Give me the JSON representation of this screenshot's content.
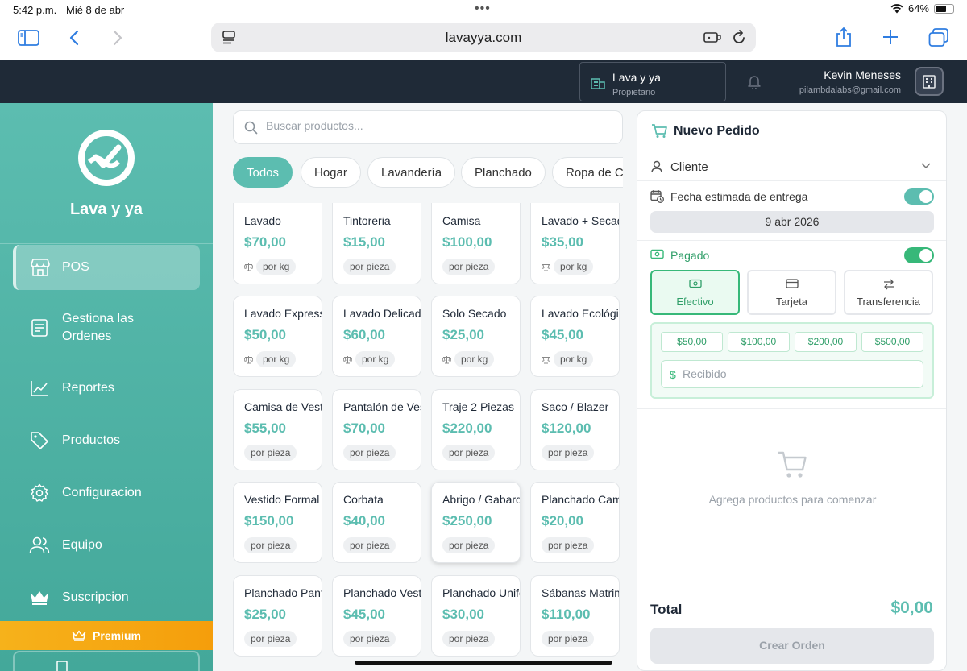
{
  "status_bar": {
    "time": "5:42 p.m.",
    "date": "Mié 8 de abr",
    "battery": "64%",
    "battery_level": 0.64
  },
  "browser": {
    "url": "lavayya.com"
  },
  "header": {
    "business_name": "Lava y ya",
    "business_role": "Propietario",
    "user_name": "Kevin Meneses",
    "user_email": "pilambdalabs@gmail.com"
  },
  "sidebar": {
    "brand": "Lava y ya",
    "items": [
      {
        "label": "POS",
        "icon": "store-icon",
        "active": true
      },
      {
        "label": "Gestiona las Ordenes",
        "icon": "clipboard-icon",
        "active": false
      },
      {
        "label": "Reportes",
        "icon": "chart-line-icon",
        "active": false
      },
      {
        "label": "Productos",
        "icon": "tag-icon",
        "active": false
      },
      {
        "label": "Configuracion",
        "icon": "gear-icon",
        "active": false
      },
      {
        "label": "Equipo",
        "icon": "users-icon",
        "active": false
      },
      {
        "label": "Suscripcion",
        "icon": "crown-icon",
        "active": false
      }
    ],
    "premium_label": "Premium"
  },
  "search": {
    "placeholder": "Buscar productos..."
  },
  "categories": [
    "Todos",
    "Hogar",
    "Lavandería",
    "Planchado",
    "Ropa de Cama"
  ],
  "active_category": "Todos",
  "products": [
    {
      "name": "Lavado",
      "price": "$70,00",
      "unit": "por kg"
    },
    {
      "name": "Tintoreria",
      "price": "$15,00",
      "unit": "por pieza"
    },
    {
      "name": "Camisa",
      "price": "$100,00",
      "unit": "por pieza"
    },
    {
      "name": "Lavado + Secado",
      "price": "$35,00",
      "unit": "por kg"
    },
    {
      "name": "Lavado Express",
      "price": "$50,00",
      "unit": "por kg"
    },
    {
      "name": "Lavado Delicado",
      "price": "$60,00",
      "unit": "por kg"
    },
    {
      "name": "Solo Secado",
      "price": "$25,00",
      "unit": "por kg"
    },
    {
      "name": "Lavado Ecológico",
      "price": "$45,00",
      "unit": "por kg"
    },
    {
      "name": "Camisa de Vestir",
      "price": "$55,00",
      "unit": "por pieza"
    },
    {
      "name": "Pantalón de Vestir",
      "price": "$70,00",
      "unit": "por pieza"
    },
    {
      "name": "Traje 2 Piezas",
      "price": "$220,00",
      "unit": "por pieza"
    },
    {
      "name": "Saco / Blazer",
      "price": "$120,00",
      "unit": "por pieza"
    },
    {
      "name": "Vestido Formal",
      "price": "$150,00",
      "unit": "por pieza"
    },
    {
      "name": "Corbata",
      "price": "$40,00",
      "unit": "por pieza"
    },
    {
      "name": "Abrigo / Gabardina",
      "price": "$250,00",
      "unit": "por pieza"
    },
    {
      "name": "Planchado Camisa",
      "price": "$20,00",
      "unit": "por pieza"
    },
    {
      "name": "Planchado Pantalón",
      "price": "$25,00",
      "unit": "por pieza"
    },
    {
      "name": "Planchado Vestido",
      "price": "$45,00",
      "unit": "por pieza"
    },
    {
      "name": "Planchado Uniforme",
      "price": "$30,00",
      "unit": "por pieza"
    },
    {
      "name": "Sábanas Matrimoniales",
      "price": "$110,00",
      "unit": "por pieza"
    }
  ],
  "order": {
    "title": "Nuevo Pedido",
    "client_label": "Cliente",
    "delivery_label": "Fecha estimada de entrega",
    "delivery_enabled": true,
    "delivery_date": "9 abr 2026",
    "paid_label": "Pagado",
    "paid_enabled": true,
    "payment_methods": [
      {
        "label": "Efectivo",
        "icon": "cash-icon",
        "active": true
      },
      {
        "label": "Tarjeta",
        "icon": "card-icon",
        "active": false
      },
      {
        "label": "Transferencia",
        "icon": "transfer-icon",
        "active": false
      }
    ],
    "quick_amounts": [
      "$50,00",
      "$100,00",
      "$200,00",
      "$500,00"
    ],
    "currency_symbol": "$",
    "received_placeholder": "Recibido",
    "empty_message": "Agrega productos para comenzar",
    "total_label": "Total",
    "total_value": "$0,00",
    "create_button": "Crear Orden"
  },
  "colors": {
    "accent": "#5cbdb0",
    "success": "#37b879",
    "header_bg": "#1f2a37",
    "premium": "#f59e0b"
  }
}
